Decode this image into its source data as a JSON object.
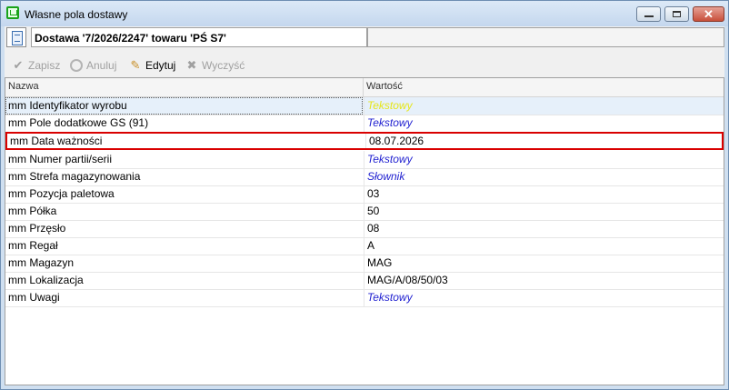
{
  "window": {
    "title": "Własne pola dostawy"
  },
  "docbar": {
    "document_label": "Dostawa '7/2026/2247' towaru 'PŚ S7'"
  },
  "toolbar": {
    "save_label": "Zapisz",
    "cancel_label": "Anuluj",
    "edit_label": "Edytuj",
    "clear_label": "Wyczyść"
  },
  "grid": {
    "headers": {
      "name": "Nazwa",
      "value": "Wartość"
    },
    "rows": [
      {
        "name": "mm Identyfikator wyrobu",
        "value": "Tekstowy"
      },
      {
        "name": "mm Pole dodatkowe GS (91)",
        "value": "Tekstowy"
      },
      {
        "name": "mm Data ważności",
        "value": "08.07.2026"
      },
      {
        "name": "mm Numer partii/serii",
        "value": "Tekstowy"
      },
      {
        "name": "mm Strefa magazynowania",
        "value": "Słownik"
      },
      {
        "name": "mm Pozycja paletowa",
        "value": "03"
      },
      {
        "name": "mm Półka",
        "value": "50"
      },
      {
        "name": "mm Przęsło",
        "value": "08"
      },
      {
        "name": "mm Regał",
        "value": "A"
      },
      {
        "name": "mm Magazyn",
        "value": "MAG"
      },
      {
        "name": "mm Lokalizacja",
        "value": "MAG/A/08/50/03"
      },
      {
        "name": "mm Uwagi",
        "value": "Tekstowy"
      }
    ]
  },
  "colors": {
    "highlight_border": "#d90000",
    "type_text": "#1f1fd0",
    "selected_type_text": "#e6e61a"
  }
}
